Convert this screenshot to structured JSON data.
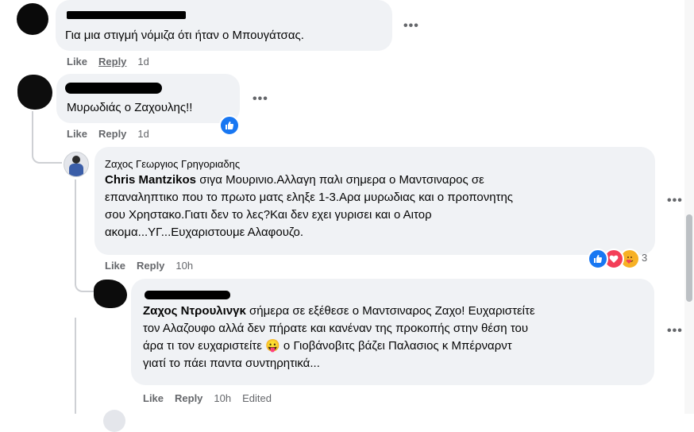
{
  "comments": [
    {
      "text": "Για μια στιγμή νόμιζα ότι ήταν ο Μπουγάτσας.",
      "actions": {
        "like": "Like",
        "reply": "Reply",
        "time": "1d"
      },
      "more": "•••"
    },
    {
      "text": "Μυρωδιάς ο Ζαχουλης!!",
      "actions": {
        "like": "Like",
        "reply": "Reply",
        "time": "1d"
      },
      "more": "•••",
      "reaction_icon": "like-reaction-icon"
    },
    {
      "author": "Ζαχος Γεωργιος Γρηγοριαδης",
      "mention": "Chris Mantzikos",
      "lines": [
        " σιγα Μουρινιο.Αλλαγη παλι σημερα ο Μαντσιναρος σε",
        "επαναληπτικο που το πρωτο ματς εληξε 1-3.Αρα μυρωδιας και ο προπονητης",
        "σου Χρηστακο.Γιατι δεν το λες?Και δεν εχει γυρισει και ο Αιτορ",
        "ακομα...ΥΓ...Ευχαριστουμε Αλαφουζο."
      ],
      "actions": {
        "like": "Like",
        "reply": "Reply",
        "time": "10h"
      },
      "more": "•••",
      "reaction_count": "3",
      "reaction_icons": [
        "like-reaction-icon",
        "love-reaction-icon",
        "care-reaction-icon"
      ]
    },
    {
      "mention": "Ζαχος Ντρουλινγκ",
      "lines": [
        " σήμερα σε εξέθεσε ο Μαντσιναρος Ζαχο! Ευχαριστείτε",
        "τον Αλαζουφο αλλά δεν πήρατε και κανέναν της προκοπής στην θέση του",
        "άρα τι τον ευχαριστείτε",
        " ο Γιοβάνοβιτς βάζει Παλασιος κ Μπέρναρντ",
        "γιατί το πάει παντα συντηρητικά..."
      ],
      "emoji": "😛",
      "actions": {
        "like": "Like",
        "reply": "Reply",
        "time": "10h",
        "edited": "Edited"
      },
      "more": "•••"
    }
  ],
  "colors": {
    "bubble": "#f0f2f5",
    "meta": "#65676b",
    "like_blue": "#1877f2",
    "love_red": "#f33e58",
    "care_yellow": "#f7b125"
  }
}
